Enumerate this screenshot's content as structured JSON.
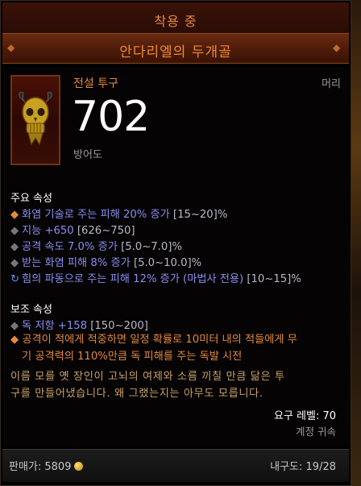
{
  "header": {
    "equipped_label": "착용 중",
    "item_name": "안다리엘의 두개골"
  },
  "item": {
    "type": "전설 투구",
    "slot": "머리",
    "armor_value": "702",
    "armor_label": "방어도"
  },
  "primary": {
    "title": "주요 속성",
    "stats": [
      {
        "text": "화염 기술로 주는 피해 20% 증가 ",
        "range": "[15~20]%"
      },
      {
        "text": "지능 +650 ",
        "range": "[626~750]"
      },
      {
        "text": "공격 속도 7.0% 증가 ",
        "range": "[5.0~7.0]%"
      },
      {
        "text": "받는 화염 피해 8% 증가 ",
        "range": "[5.0~10.0]%"
      },
      {
        "text": "힘의 파동으로 주는 피해 12% 증가 (마법사 전용) ",
        "range": "[10~15]%"
      }
    ]
  },
  "secondary": {
    "title": "보조 속성",
    "stats": [
      {
        "text": "독 저항 +158 ",
        "range": "[150~200]"
      }
    ],
    "legendary_line1": "공격이 적에게 적중하면 일정 확률로 10미터 내의 적들에게 무",
    "legendary_line2": "기 공격력의 110%만큼 독 피해를 주는 독발 시전"
  },
  "flavor": {
    "line1": "이름 모를 옛 장인이 고뇌의 여제와 소름 끼칠 만큼 닮은 투",
    "line2": "구를 만들어냈습니다. 왜 그랬는지는 아무도 모릅니다."
  },
  "requirements": {
    "level": "요구 레벨: 70",
    "binding": "계정 귀속"
  },
  "footer": {
    "sell_label": "판매가: 5809",
    "durability": "내구도: 19/28"
  },
  "colors": {
    "legendary_orange": "#e48a3c",
    "magic_blue": "#8a8ef0",
    "flavor_gold": "#c9a06a"
  }
}
